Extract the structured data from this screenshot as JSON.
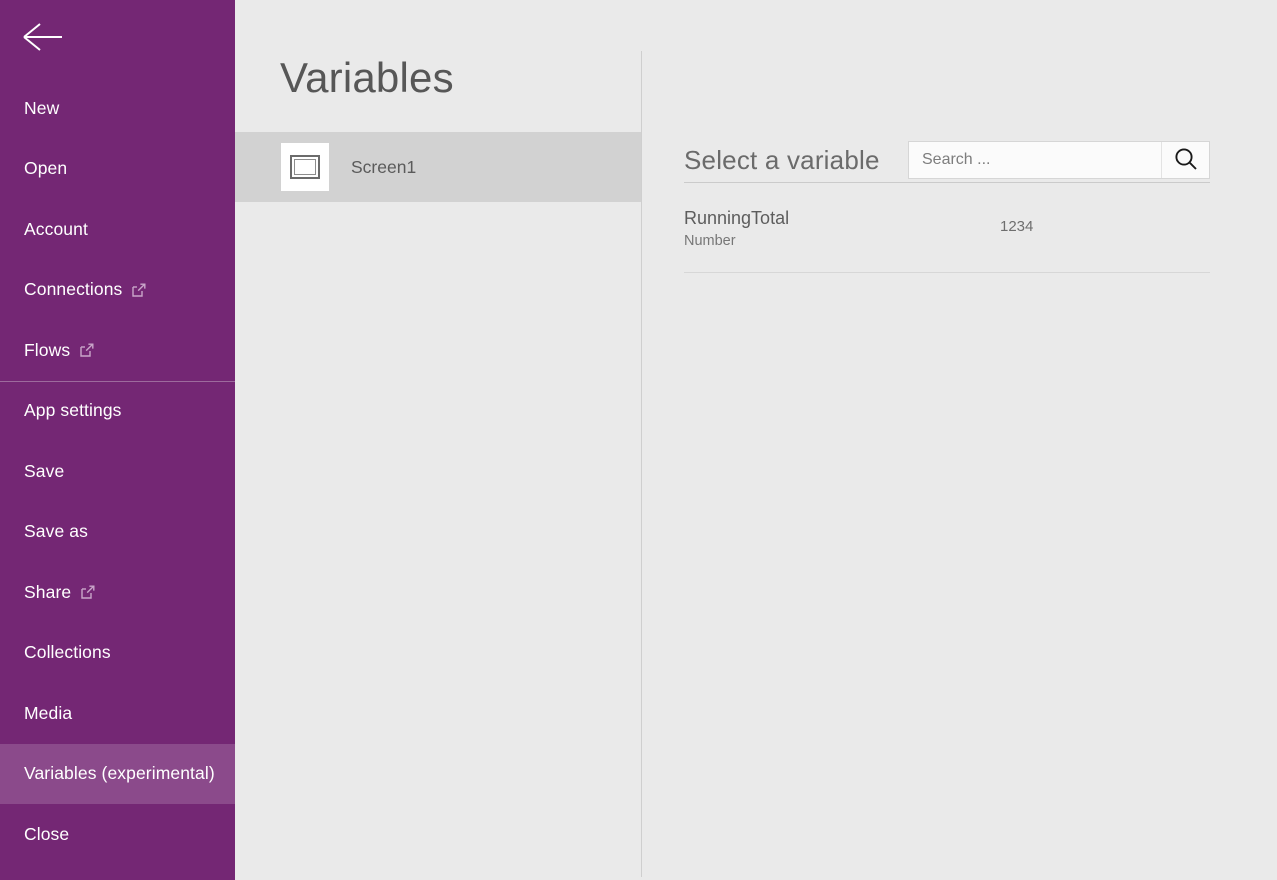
{
  "sidebar": {
    "back_label": "Back",
    "back_icon": "arrow-left-icon",
    "external_icon": "open-in-new-window-icon",
    "items": [
      {
        "label": "New",
        "external": false,
        "selected": false,
        "divider": false
      },
      {
        "label": "Open",
        "external": false,
        "selected": false,
        "divider": false
      },
      {
        "label": "Account",
        "external": false,
        "selected": false,
        "divider": false
      },
      {
        "label": "Connections",
        "external": true,
        "selected": false,
        "divider": false
      },
      {
        "label": "Flows",
        "external": true,
        "selected": false,
        "divider": false
      },
      {
        "label": "App settings",
        "external": false,
        "selected": false,
        "divider": true
      },
      {
        "label": "Save",
        "external": false,
        "selected": false,
        "divider": false
      },
      {
        "label": "Save as",
        "external": false,
        "selected": false,
        "divider": false
      },
      {
        "label": "Share",
        "external": true,
        "selected": false,
        "divider": false
      },
      {
        "label": "Collections",
        "external": false,
        "selected": false,
        "divider": false
      },
      {
        "label": "Media",
        "external": false,
        "selected": false,
        "divider": false
      },
      {
        "label": "Variables (experimental)",
        "external": false,
        "selected": true,
        "divider": false
      },
      {
        "label": "Close",
        "external": false,
        "selected": false,
        "divider": false
      }
    ]
  },
  "screens_panel": {
    "title": "Variables",
    "screens": [
      {
        "name": "Screen1",
        "icon": "screen-thumbnail-icon",
        "selected": true
      }
    ]
  },
  "variables_panel": {
    "header_title": "Select a variable",
    "search": {
      "value": "",
      "placeholder": "Search ...",
      "icon": "search-icon"
    },
    "variables": [
      {
        "name": "RunningTotal",
        "type": "Number",
        "value": "1234"
      }
    ]
  },
  "colors": {
    "sidebar_purple": "#742774",
    "sidebar_selected": "#8b4a8b",
    "panel_background": "#eaeaea",
    "row_selected": "#d2d2d2",
    "text_primary": "#575757",
    "text_secondary": "#777777"
  }
}
